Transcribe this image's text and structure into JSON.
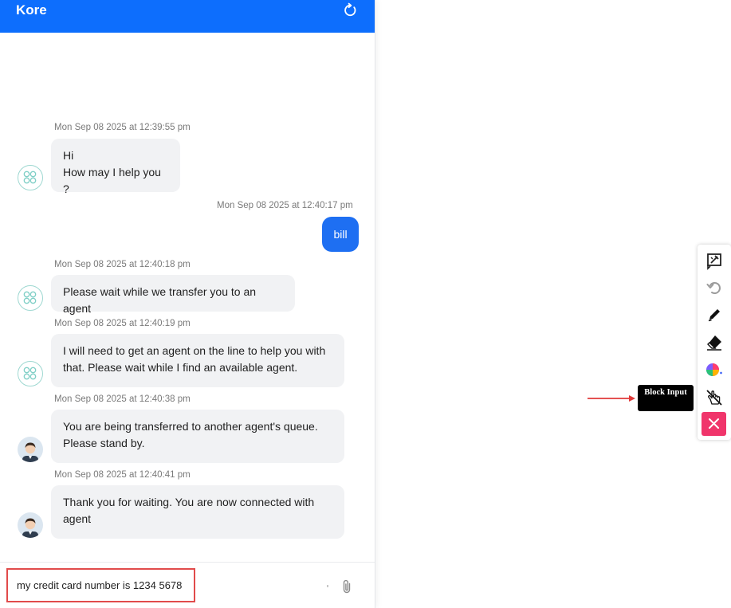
{
  "header": {
    "title": "Kore",
    "refresh_icon": "refresh-icon"
  },
  "messages": [
    {
      "sender": "bot",
      "timestamp": "Mon Sep 08 2025 at 12:39:55 pm",
      "lines": [
        "Hi",
        "How may I help you ?"
      ]
    },
    {
      "sender": "user",
      "timestamp": "Mon Sep 08 2025 at 12:40:17 pm",
      "lines": [
        "bill"
      ]
    },
    {
      "sender": "bot",
      "timestamp": "Mon Sep 08 2025 at 12:40:18 pm",
      "lines": [
        "Please wait while we transfer you to an agent"
      ]
    },
    {
      "sender": "bot",
      "timestamp": "Mon Sep 08 2025 at 12:40:19 pm",
      "lines": [
        "I will need to get an agent on the line to help you with",
        "that. Please wait while I find an available agent."
      ]
    },
    {
      "sender": "agent",
      "timestamp": "Mon Sep 08 2025 at 12:40:38 pm",
      "lines": [
        "You are being transferred to another agent's queue.",
        "Please stand by."
      ]
    },
    {
      "sender": "agent",
      "timestamp": "Mon Sep 08 2025 at 12:40:41 pm",
      "lines": [
        "Thank you for waiting. You are now connected with",
        "agent"
      ]
    }
  ],
  "composer": {
    "input_value": "my credit card number is 1234 5678",
    "attach_icon": "paperclip-icon"
  },
  "toolbar": {
    "tools": [
      "annotate-icon",
      "redo-icon",
      "pen-icon",
      "eraser-icon",
      "color-palette-icon",
      "block-input-hand-icon"
    ],
    "close_icon": "close-icon"
  },
  "tooltip": {
    "text": "Block Input"
  },
  "colors": {
    "header": "#0d6efd",
    "user_bubble": "#1e6ff2",
    "bot_bubble": "#f1f2f4",
    "highlight": "#e14b4b",
    "close": "#f0356b"
  }
}
